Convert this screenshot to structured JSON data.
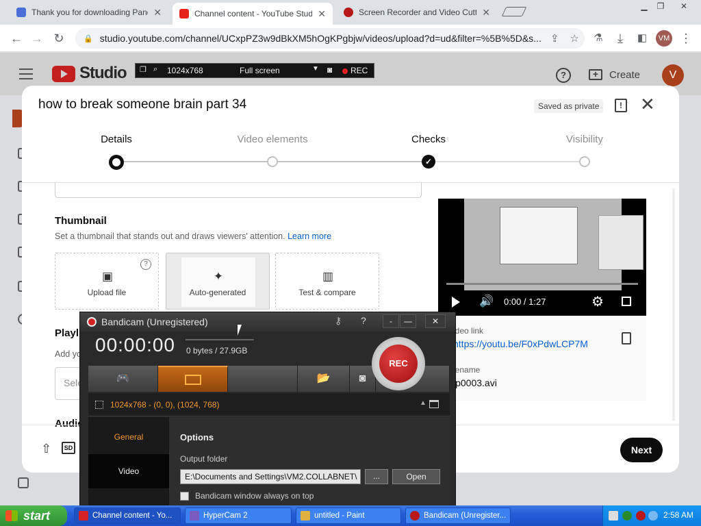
{
  "browser": {
    "tabs": [
      {
        "title": "Thank you for downloading Pando",
        "active": false
      },
      {
        "title": "Channel content - YouTube Studio",
        "active": true
      },
      {
        "title": "Screen Recorder and Video Cutter",
        "active": false
      }
    ],
    "url": "studio.youtube.com/channel/UCxpPZ3w9dBkXM5hOgKPgbjw/videos/upload?d=ud&filter=%5B%5D&s...",
    "profile_initials": "VM"
  },
  "studio": {
    "logo_text": "Studio",
    "create_label": "Create",
    "avatar_letter": "V"
  },
  "bandicam_bar": {
    "resolution": "1024x768",
    "mode": "Full screen",
    "rec": "REC"
  },
  "dialog": {
    "title": "how to break someone brain part 34",
    "saved_status": "Saved as private",
    "steps": [
      {
        "label": "Details",
        "state": "current"
      },
      {
        "label": "Video elements",
        "state": "upcoming"
      },
      {
        "label": "Checks",
        "state": "done"
      },
      {
        "label": "Visibility",
        "state": "upcoming"
      }
    ],
    "thumbnail": {
      "heading": "Thumbnail",
      "description": "Set a thumbnail that stands out and draws viewers' attention.",
      "learn_more": "Learn more",
      "options": [
        "Upload file",
        "Auto-generated",
        "Test & compare"
      ]
    },
    "playlists": {
      "heading": "Playli",
      "description": "Add yo",
      "select_placeholder": "Sele"
    },
    "audience_heading": "Audie",
    "player": {
      "time": "0:00 / 1:27"
    },
    "video_link_label": "ideo link",
    "video_link": "https://youtu.be/F0xPdwLCP7M",
    "filename_label": "lename",
    "filename": "ip0003.avi",
    "footer": {
      "hd_badge": "SD",
      "next_label": "Next"
    }
  },
  "bandicam": {
    "title": "Bandicam (Unregistered)",
    "help": "?",
    "timer": "00:00:00",
    "size": "0 bytes / 27.9GB",
    "rec_label": "REC",
    "capture_info": "1024x768 - (0, 0), (1024, 768)",
    "nav": [
      "General",
      "Video"
    ],
    "options_heading": "Options",
    "output_folder_label": "Output folder",
    "output_folder_value": "E:\\Documents and Settings\\VM2.COLLABNET\\",
    "browse_label": "...",
    "open_label": "Open",
    "always_on_top_label": "Bandicam window always on top"
  },
  "taskbar": {
    "start_label": "start",
    "tasks": [
      {
        "label": "Channel content - Yo...",
        "icon_color": "#d32222"
      },
      {
        "label": "HyperCam 2",
        "icon_color": "#7a5cc0"
      },
      {
        "label": "untitled - Paint",
        "icon_color": "#e0b040"
      },
      {
        "label": "Bandicam (Unregister...",
        "icon_color": "#b81818"
      }
    ],
    "clock": "2:58 AM"
  },
  "colors": {
    "accent_blue": "#065fd4",
    "bandicam_orange": "#f39a2c",
    "rec_red": "#c41f1f"
  }
}
